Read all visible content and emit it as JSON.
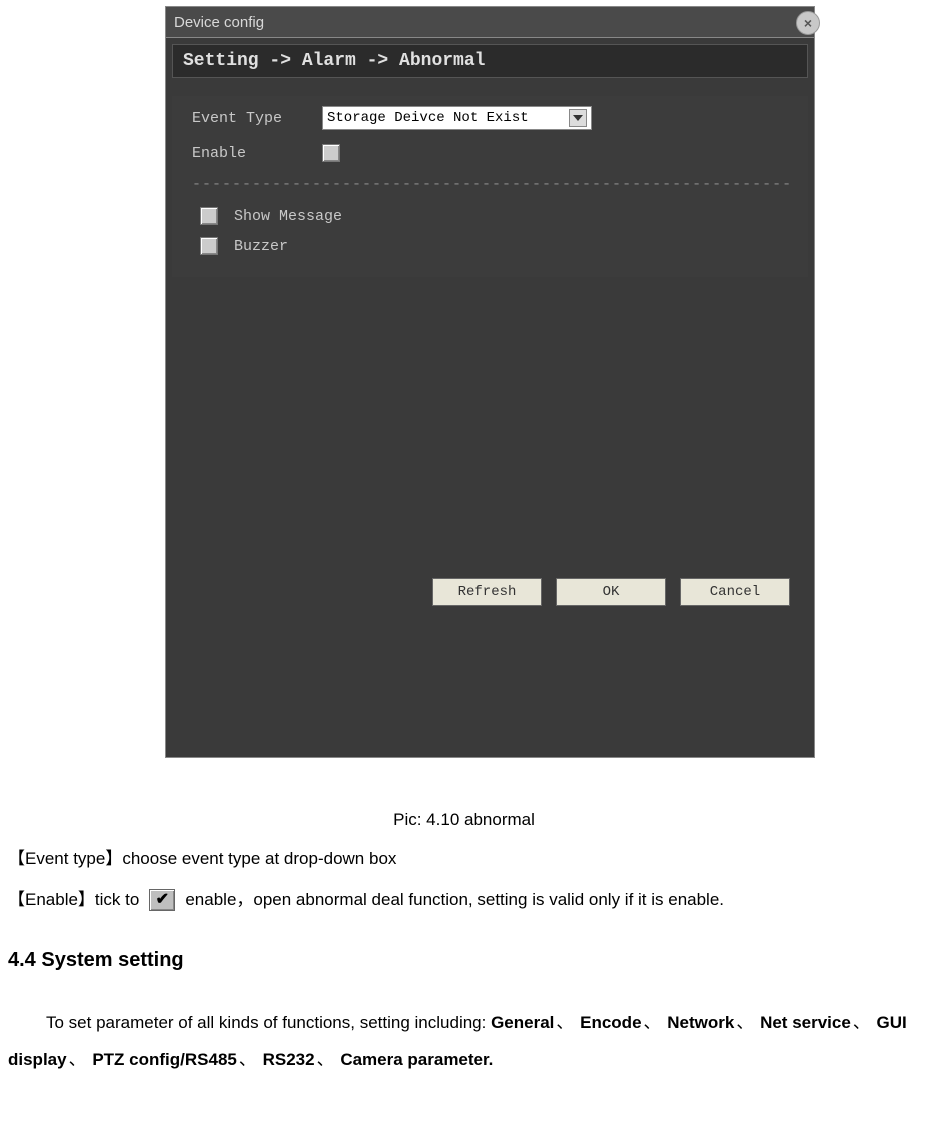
{
  "dialog": {
    "title": "Device config",
    "close": "×",
    "breadcrumb": "Setting -> Alarm -> Abnormal",
    "labels": {
      "event_type": "Event Type",
      "enable": "Enable",
      "show_message": "Show Message",
      "buzzer": "Buzzer"
    },
    "dropdown_value": "Storage Deivce Not Exist",
    "divider": "--------------------------------------------------------------------",
    "buttons": {
      "refresh": "Refresh",
      "ok": "OK",
      "cancel": "Cancel"
    }
  },
  "doc": {
    "caption": "Pic: 4.10 abnormal",
    "event_type_line_a": "【Event type】choose event type at drop-down box",
    "enable_pre": "【Enable】tick to",
    "enable_post": "enable，open abnormal deal function, setting is valid only if it is enable.",
    "heading": "4.4 System setting",
    "sys_intro": "To set parameter of all kinds of functions, setting including: ",
    "sep": "、",
    "bold": {
      "general": "General",
      "encode": "Encode",
      "network": "Network",
      "netservice": "Net service",
      "gui": "GUI display",
      "ptz": "PTZ config/RS485",
      "rs232": "RS232",
      "camera": "Camera parameter."
    }
  }
}
